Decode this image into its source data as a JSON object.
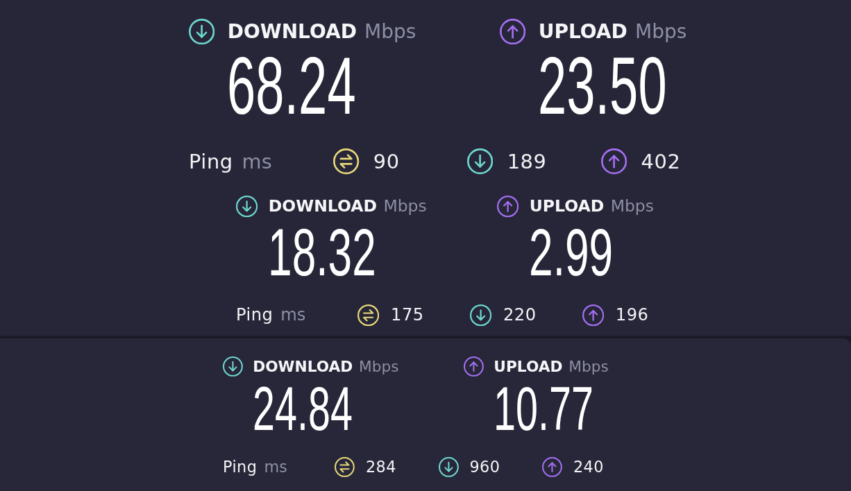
{
  "panels": [
    {
      "results": [
        {
          "speeds": [
            {
              "kind": "download",
              "label": "DOWNLOAD",
              "unit": "Mbps",
              "value": "68.24"
            },
            {
              "kind": "upload",
              "label": "UPLOAD",
              "unit": "Mbps",
              "value": "23.50"
            }
          ],
          "ping": {
            "label": "Ping",
            "unit": "ms",
            "stats": [
              {
                "kind": "idle",
                "value": "90"
              },
              {
                "kind": "download",
                "value": "189"
              },
              {
                "kind": "upload",
                "value": "402"
              }
            ]
          }
        },
        {
          "speeds": [
            {
              "kind": "download",
              "label": "DOWNLOAD",
              "unit": "Mbps",
              "value": "18.32"
            },
            {
              "kind": "upload",
              "label": "UPLOAD",
              "unit": "Mbps",
              "value": "2.99"
            }
          ],
          "ping": {
            "label": "Ping",
            "unit": "ms",
            "stats": [
              {
                "kind": "idle",
                "value": "175"
              },
              {
                "kind": "download",
                "value": "220"
              },
              {
                "kind": "upload",
                "value": "196"
              }
            ]
          }
        }
      ]
    },
    {
      "results": [
        {
          "speeds": [
            {
              "kind": "download",
              "label": "DOWNLOAD",
              "unit": "Mbps",
              "value": "24.84"
            },
            {
              "kind": "upload",
              "label": "UPLOAD",
              "unit": "Mbps",
              "value": "10.77"
            }
          ],
          "ping": {
            "label": "Ping",
            "unit": "ms",
            "stats": [
              {
                "kind": "idle",
                "value": "284"
              },
              {
                "kind": "download",
                "value": "960"
              },
              {
                "kind": "upload",
                "value": "240"
              }
            ]
          }
        }
      ]
    }
  ]
}
